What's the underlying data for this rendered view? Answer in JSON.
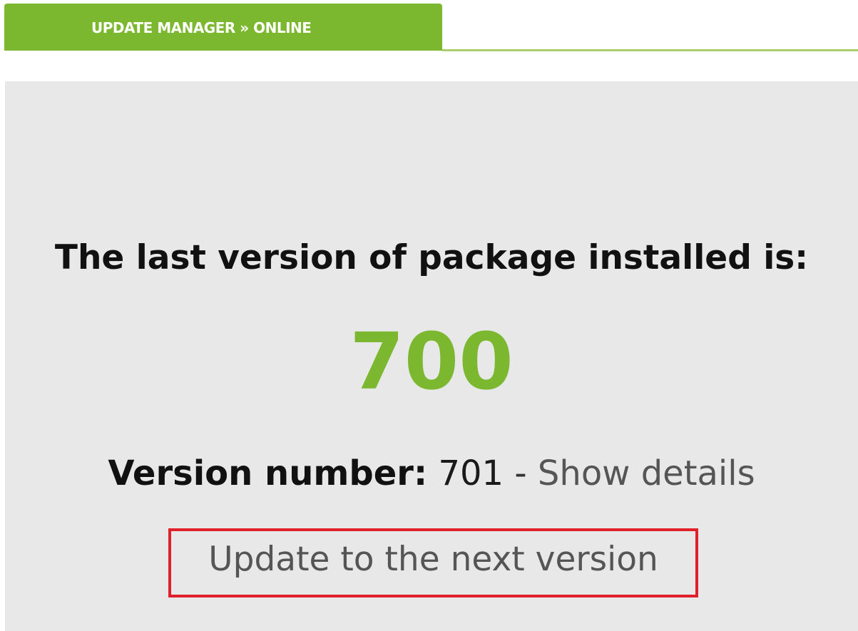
{
  "tab": {
    "label": "UPDATE MANAGER » ONLINE"
  },
  "main": {
    "heading": "The last version of package installed is:",
    "installed_version": "700",
    "version_label": "Version number:",
    "version_value": "701",
    "separator": "-",
    "details_link": "Show details",
    "update_link": "Update to the next version"
  },
  "colors": {
    "accent": "#7cb82f",
    "highlight_border": "#e0202a",
    "panel_background": "#e8e8e8"
  }
}
